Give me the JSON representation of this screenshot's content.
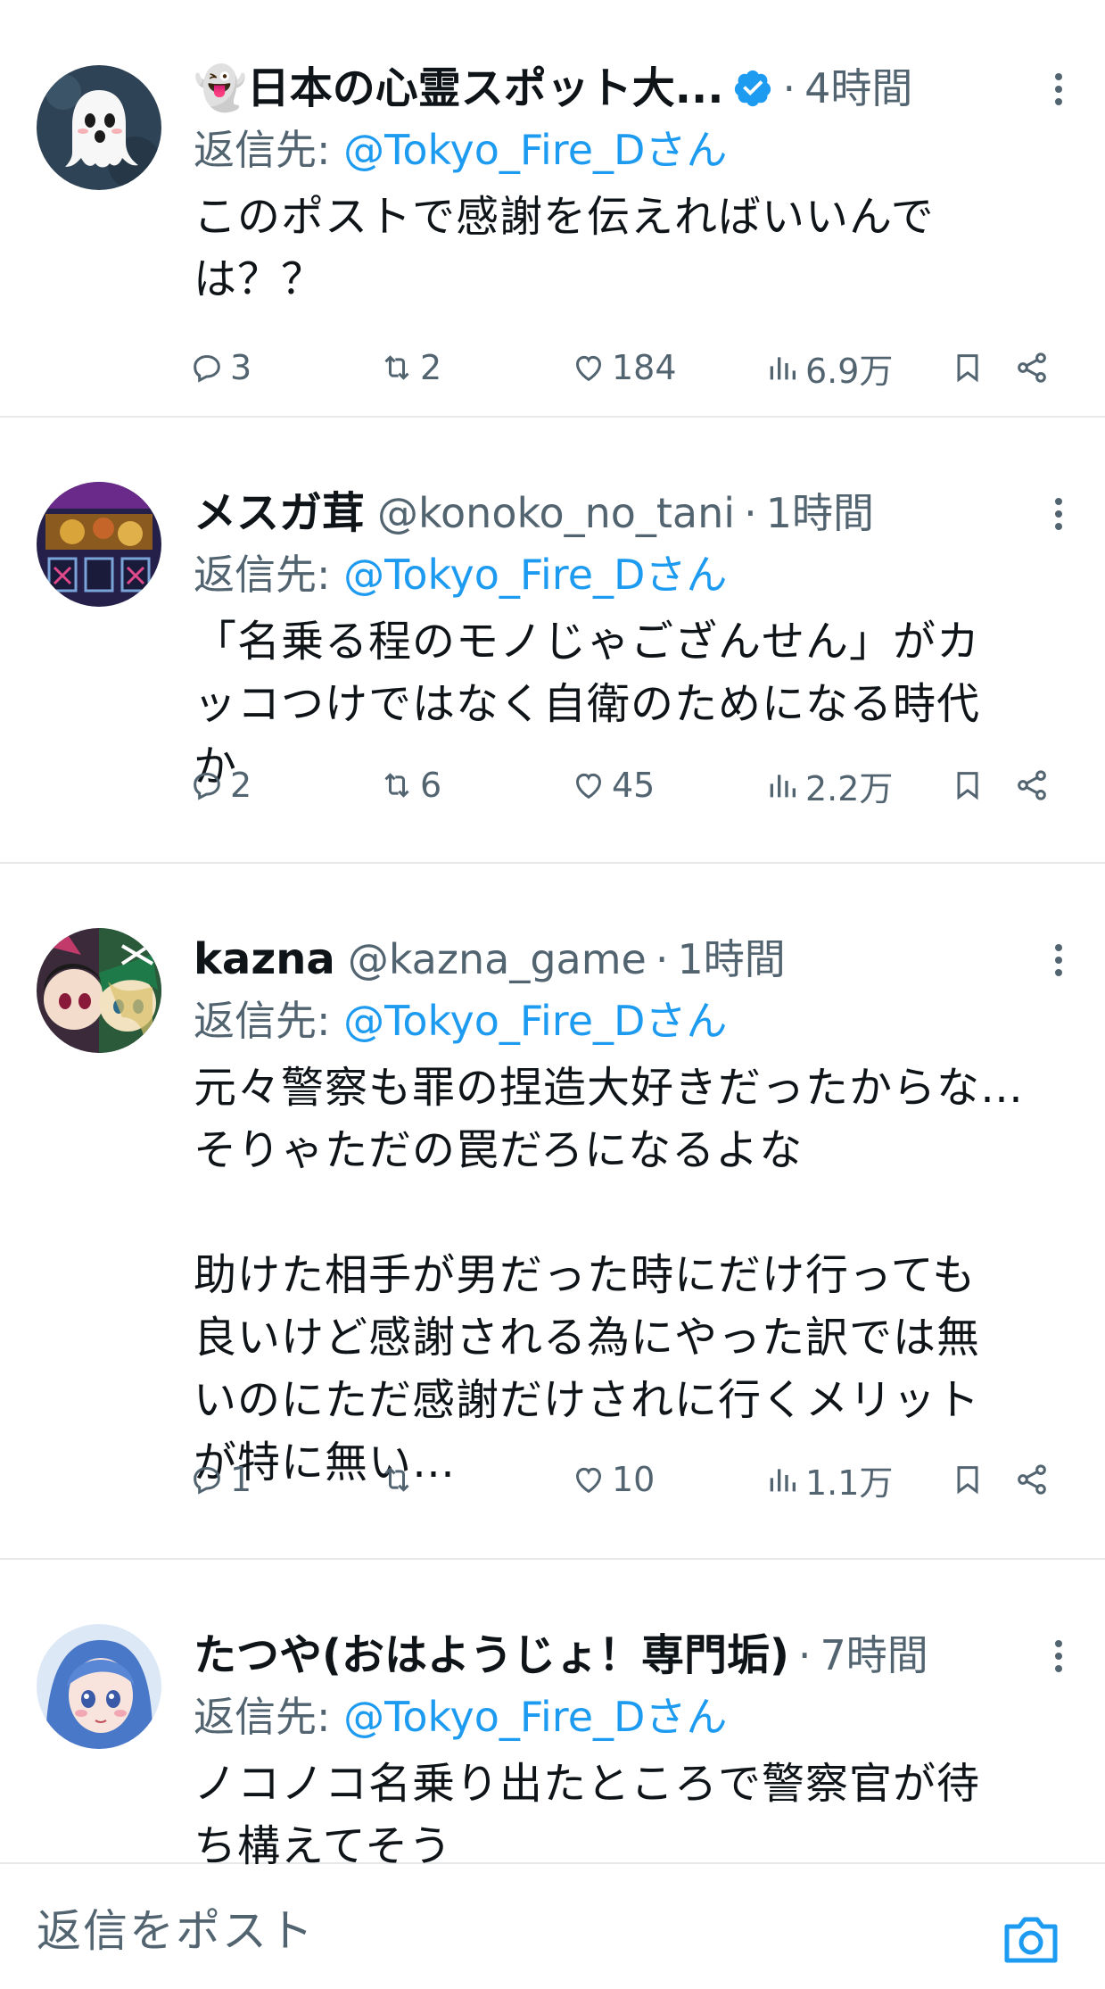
{
  "tweets": [
    {
      "display_name": "👻日本の心霊スポット大...",
      "handle": "",
      "verified": true,
      "time": "4時間",
      "reply_prefix": "返信先: ",
      "reply_mention": "@Tokyo_Fire_Dさん",
      "text": "このポストで感謝を伝えればいいんで\nは？？",
      "replies": "3",
      "retweets": "2",
      "likes": "184",
      "views": "6.9万"
    },
    {
      "display_name": "メスガ茸",
      "handle": "@konoko_no_tani",
      "verified": false,
      "time": "1時間",
      "reply_prefix": "返信先: ",
      "reply_mention": "@Tokyo_Fire_Dさん",
      "text": "「名乗る程のモノじゃござんせん」がカ\nッコつけではなく自衛のためになる時代\nか",
      "replies": "2",
      "retweets": "6",
      "likes": "45",
      "views": "2.2万"
    },
    {
      "display_name": "kazna",
      "handle": "@kazna_game",
      "verified": false,
      "time": "1時間",
      "reply_prefix": "返信先: ",
      "reply_mention": "@Tokyo_Fire_Dさん",
      "text": "元々警察も罪の捏造大好きだったからな…\nそりゃただの罠だろになるよな\n\n助けた相手が男だった時にだけ行っても\n良いけど感謝される為にやった訳では無\nいのにただ感謝だけされに行くメリット\nが特に無い…",
      "replies": "1",
      "retweets": "",
      "likes": "10",
      "views": "1.1万"
    },
    {
      "display_name": "たつや(おはようじょ！専門垢)",
      "handle": "",
      "verified": false,
      "time": "7時間",
      "reply_prefix": "返信先: ",
      "reply_mention": "@Tokyo_Fire_Dさん",
      "text": "ノコノコ名乗り出たところで警察官が待\nち構えてそう"
    }
  ],
  "separator": "·",
  "composer": {
    "placeholder": "返信をポスト"
  },
  "colors": {
    "accent": "#1d9bf0",
    "secondary_text": "#536471",
    "divider": "#e6e8ea"
  }
}
